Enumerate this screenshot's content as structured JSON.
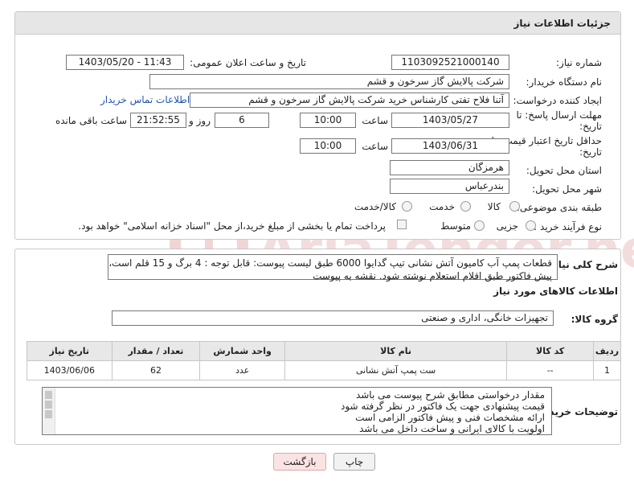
{
  "header": {
    "title": "جزئیات اطلاعات نیاز"
  },
  "labels": {
    "need_number": "شماره نیاز:",
    "announce_datetime": "تاریخ و ساعت اعلان عمومی:",
    "buyer_org": "نام دستگاه خریدار:",
    "requester": "ایجاد کننده درخواست:",
    "reply_deadline_1": "مهلت ارسال پاسخ: تا",
    "reply_deadline_2": "تاریخ:",
    "time": "ساعت",
    "day_and": "روز و",
    "remaining": "ساعت باقی مانده",
    "price_deadline_1": "حداقل تاریخ اعتبار قیمت: تا",
    "price_deadline_2": "تاریخ:",
    "province": "استان محل تحویل:",
    "city": "شهر محل تحویل:",
    "category": "طبقه بندی موضوعی:",
    "purchase_type": "نوع فرآیند خرید :",
    "general_desc": "شرح کلی نیاز:",
    "goods_info": "اطلاعات کالاهای مورد نیاز",
    "goods_group": "گروه کالا:",
    "buyer_notes": "توضیحات خریدار:"
  },
  "values": {
    "need_number": "1103092521000140",
    "announce_datetime": "1403/05/20 - 11:43",
    "buyer_org": "شرکت پالایش گاز سرخون و قشم",
    "requester": "آتنا فلاح تفتی کارشناس خرید شرکت پالایش گاز سرخون و قشم",
    "contact_link": "اطلاعات تماس خریدار",
    "reply_date": "1403/05/27",
    "reply_time": "10:00",
    "days": "6",
    "remaining_time": "21:52:55",
    "price_date": "1403/06/31",
    "price_time": "10:00",
    "province": "هرمزگان",
    "city": "بندرعباس",
    "category_options": [
      "کالا",
      "خدمت",
      "کالا/خدمت"
    ],
    "purchase_options": [
      "جزیی",
      "متوسط"
    ],
    "payment_note": "پرداخت تمام یا بخشی از مبلغ خرید،از محل \"اسناد خزانه اسلامی\" خواهد بود.",
    "general_desc_line1": "قطعات پمپ آب کامیون آتش نشانی تیپ گدایوا 6000 طبق لیست پیوست:  قابل توجه : 4 برگ و 15 قلم است،",
    "general_desc_line2": "پیش فاکتور طبق اقلام استعلام نوشته شود. نقشه به پیوست",
    "goods_group": "تجهیزات خانگی، اداری و صنعتی"
  },
  "table": {
    "headers": [
      "ردیف",
      "کد کالا",
      "نام کالا",
      "واحد شمارش",
      "تعداد / مقدار",
      "تاریخ نیاز"
    ],
    "rows": [
      [
        "1",
        "--",
        "ست پمپ آتش نشانی",
        "عدد",
        "62",
        "1403/06/06"
      ]
    ]
  },
  "notes": [
    "مقدار درخواستی مطابق شرح پیوست می باشد",
    "قیمت پیشنهادی جهت یک فاکتور در نظر گرفته شود",
    "ارائه مشخصات فنی و پیش فاکتور الزامی است",
    "اولویت با کالای ایرانی و ساخت داخل می باشد"
  ],
  "buttons": {
    "print": "چاپ",
    "back": "بازگشت"
  },
  "watermark": {
    "text": "AriaTender.neT"
  },
  "colors": {
    "link": "#1f56b5",
    "back_button_bg": "#fbe3e3",
    "print_button_bg": "#f2f2f2",
    "watermark": "#f0d5d5"
  }
}
